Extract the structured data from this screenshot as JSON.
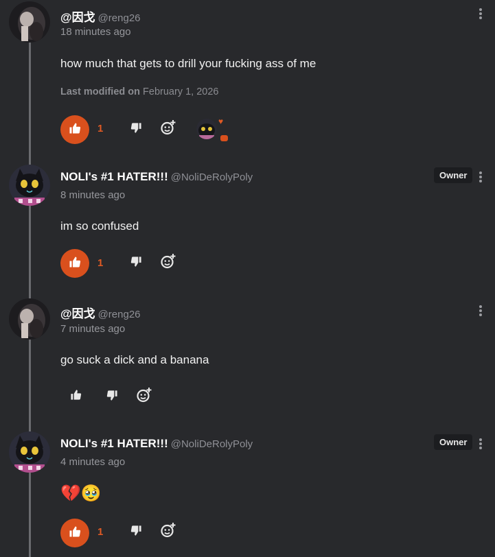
{
  "comments": [
    {
      "author": "@因戈",
      "handle": "@reng26",
      "time": "18 minutes ago",
      "text": "how much that gets to  drill your fucking ass of me",
      "modified_label": "Last modified on",
      "modified_date": "February 1, 2026",
      "likes": "1",
      "liked": true,
      "avatar": "dark-photo"
    },
    {
      "author": "NOLI's #1 HATER!!!",
      "handle": "@NoliDeRolyPoly",
      "badge": "Owner",
      "time": "8 minutes ago",
      "text": "im so confused",
      "likes": "1",
      "liked": true,
      "avatar": "black-cat"
    },
    {
      "author": "@因戈",
      "handle": "@reng26",
      "time": "7 minutes ago",
      "text": "go suck a dick and a banana",
      "liked": false,
      "avatar": "dark-photo"
    },
    {
      "author": "NOLI's #1 HATER!!!",
      "handle": "@NoliDeRolyPoly",
      "badge": "Owner",
      "time": "4 minutes ago",
      "text": "💔🥹",
      "likes": "1",
      "liked": true,
      "avatar": "black-cat"
    }
  ],
  "icons": {
    "like": "thumbs-up-icon",
    "dislike": "thumbs-down-icon",
    "react": "add-emoji-icon",
    "menu": "kebab-menu-icon"
  },
  "colors": {
    "background": "#28292c",
    "accent": "#d9501d",
    "muted": "#96979c"
  }
}
